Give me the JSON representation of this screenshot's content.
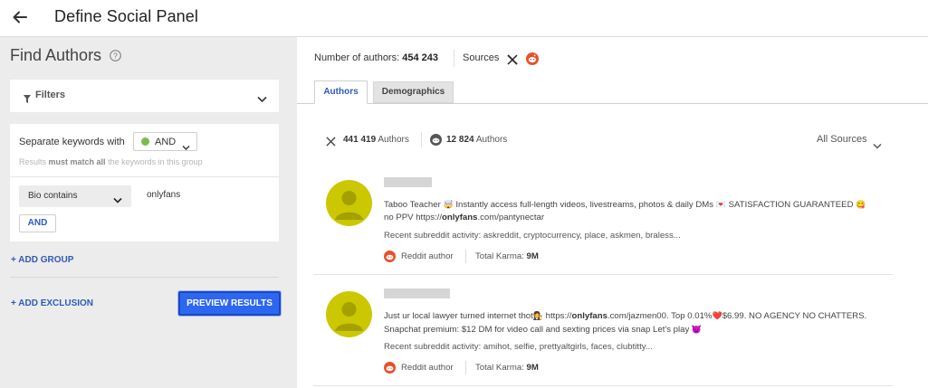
{
  "header": {
    "title": "Define Social Panel",
    "back_icon": "arrow-left-icon"
  },
  "left": {
    "title": "Find Authors",
    "filters_label": "Filters",
    "group": {
      "separate_label": "Separate keywords with",
      "operator_value": "AND",
      "hint_prefix": "Results",
      "hint_bold": "must match all",
      "hint_suffix": "the keywords in this group",
      "field_select": "Bio contains",
      "keyword": "onlyfans",
      "and_button": "AND"
    },
    "add_group": "+ ADD GROUP",
    "add_exclusion": "+ ADD EXCLUSION",
    "preview_button": "PREVIEW RESULTS",
    "colors": {
      "accent": "#2f5ab8",
      "primary_button": "#2d67f0",
      "operator_dot": "#7cbc48"
    }
  },
  "right": {
    "num_authors_label": "Number of authors:",
    "num_authors_value": "454 243",
    "sources_label": "Sources",
    "tabs": [
      {
        "label": "Authors",
        "active": true
      },
      {
        "label": "Demographics",
        "active": false
      }
    ],
    "stats": {
      "x_count": "441 419",
      "x_label": "Authors",
      "reddit_count": "12 824",
      "reddit_label": "Authors"
    },
    "source_filter": "All Sources",
    "authors": [
      {
        "bio_1": "Taboo Teacher",
        "emoji_1": "🤯",
        "bio_2": " Instantly access full-length videos, livestreams, photos & daily DMs ",
        "emoji_2": "💌",
        "bio_3": " SATISFACTION GUARANTEED ",
        "emoji_3": "😋",
        "bio_4": " no PPV https://",
        "bio_bold": "onlyfans",
        "bio_5": ".com/pantynectar",
        "activity": "Recent subreddit activity: askreddit, cryptocurrency, place, askmen, braless...",
        "source": "Reddit author",
        "karma_label": "Total Karma:",
        "karma_value": "9M"
      },
      {
        "bio_1": "Just ur local lawyer turned internet thot",
        "emoji_1": "👩‍⚖️",
        "bio_2": " https://",
        "bio_bold": "onlyfans",
        "bio_3": ".com/jazmen00. Top 0.01%",
        "emoji_2": "❤️",
        "bio_4": "$6.99. NO AGENCY NO CHATTERS. Snapchat premium: $12 DM for video call and sexting prices via snap Let's play ",
        "emoji_3": "😈",
        "activity": "Recent subreddit activity: amihot, selfie, prettyaltgirls, faces, clubtitty...",
        "source": "Reddit author",
        "karma_label": "Total Karma:",
        "karma_value": "9M"
      }
    ],
    "colors": {
      "reddit": "#e8502a",
      "avatar": "#cbc700"
    }
  }
}
